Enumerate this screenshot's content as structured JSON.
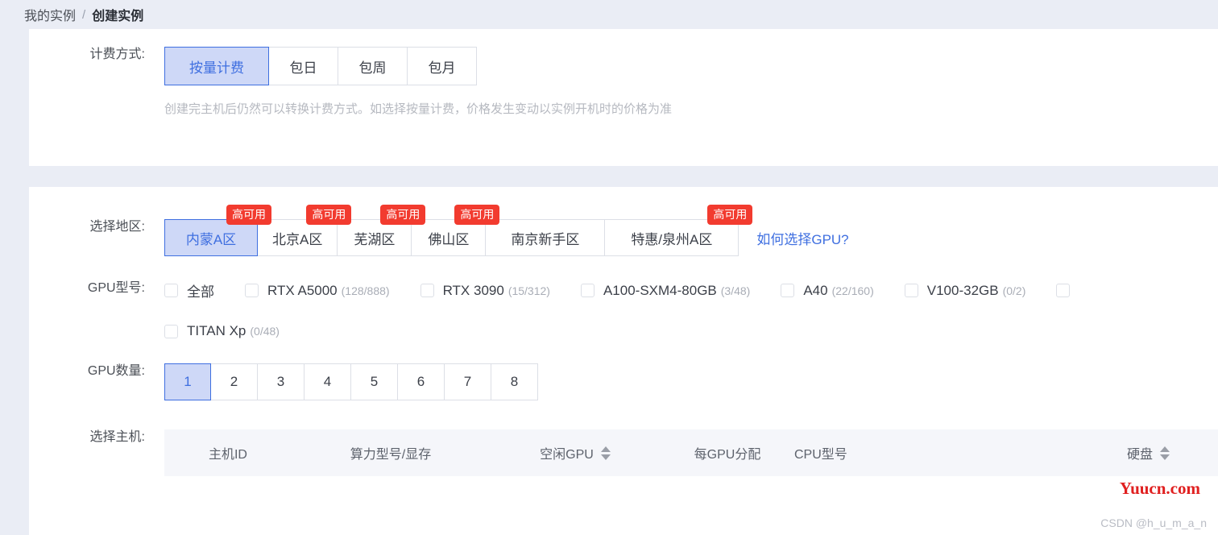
{
  "breadcrumb": {
    "parent": "我的实例",
    "separator": "/",
    "current": "创建实例"
  },
  "billing": {
    "label": "计费方式:",
    "options": [
      {
        "label": "按量计费",
        "selected": true
      },
      {
        "label": "包日",
        "selected": false
      },
      {
        "label": "包周",
        "selected": false
      },
      {
        "label": "包月",
        "selected": false
      }
    ],
    "hint": "创建完主机后仍然可以转换计费方式。如选择按量计费，价格发生变动以实例开机时的价格为准"
  },
  "region": {
    "label": "选择地区:",
    "badge_text": "高可用",
    "options": [
      {
        "label": "内蒙A区",
        "selected": true,
        "badge": true
      },
      {
        "label": "北京A区",
        "selected": false,
        "badge": true
      },
      {
        "label": "芜湖区",
        "selected": false,
        "badge": true
      },
      {
        "label": "佛山区",
        "selected": false,
        "badge": true
      },
      {
        "label": "南京新手区",
        "selected": false,
        "badge": false
      },
      {
        "label": "特惠/泉州A区",
        "selected": false,
        "badge": true
      }
    ],
    "help_link": "如何选择GPU?"
  },
  "gpu_model": {
    "label": "GPU型号:",
    "row1": [
      {
        "label": "全部",
        "count": "",
        "checked": false
      },
      {
        "label": "RTX A5000",
        "count": "(128/888)",
        "checked": false
      },
      {
        "label": "RTX 3090",
        "count": "(15/312)",
        "checked": false
      },
      {
        "label": "A100-SXM4-80GB",
        "count": "(3/48)",
        "checked": false
      },
      {
        "label": "A40",
        "count": "(22/160)",
        "checked": false
      },
      {
        "label": "V100-32GB",
        "count": "(0/2)",
        "checked": false
      },
      {
        "label": "",
        "count": "",
        "checked": false
      }
    ],
    "row2": [
      {
        "label": "TITAN Xp",
        "count": "(0/48)",
        "checked": false
      }
    ]
  },
  "gpu_count": {
    "label": "GPU数量:",
    "options": [
      {
        "label": "1",
        "selected": true
      },
      {
        "label": "2",
        "selected": false
      },
      {
        "label": "3",
        "selected": false
      },
      {
        "label": "4",
        "selected": false
      },
      {
        "label": "5",
        "selected": false
      },
      {
        "label": "6",
        "selected": false
      },
      {
        "label": "7",
        "selected": false
      },
      {
        "label": "8",
        "selected": false
      }
    ]
  },
  "host": {
    "label": "选择主机:",
    "columns": [
      {
        "title": "主机ID",
        "sortable": false
      },
      {
        "title": "算力型号/显存",
        "sortable": false
      },
      {
        "title": "空闲GPU",
        "sortable": true
      },
      {
        "title": "每GPU分配",
        "sortable": false
      },
      {
        "title": "CPU型号",
        "sortable": false
      },
      {
        "title": "硬盘",
        "sortable": true
      }
    ]
  },
  "watermarks": {
    "site": "Yuucn.com",
    "csdn": "CSDN @h_u_m_a_n"
  },
  "colors": {
    "page_bg": "#eaedf5",
    "card_bg": "#ffffff",
    "accent_blue": "#3f6fe0",
    "selected_fill": "#ced8f7",
    "badge_red": "#f23b2f",
    "table_head_bg": "#f5f6fa",
    "muted_text": "#a9adb6",
    "watermark_red": "#e02020"
  }
}
